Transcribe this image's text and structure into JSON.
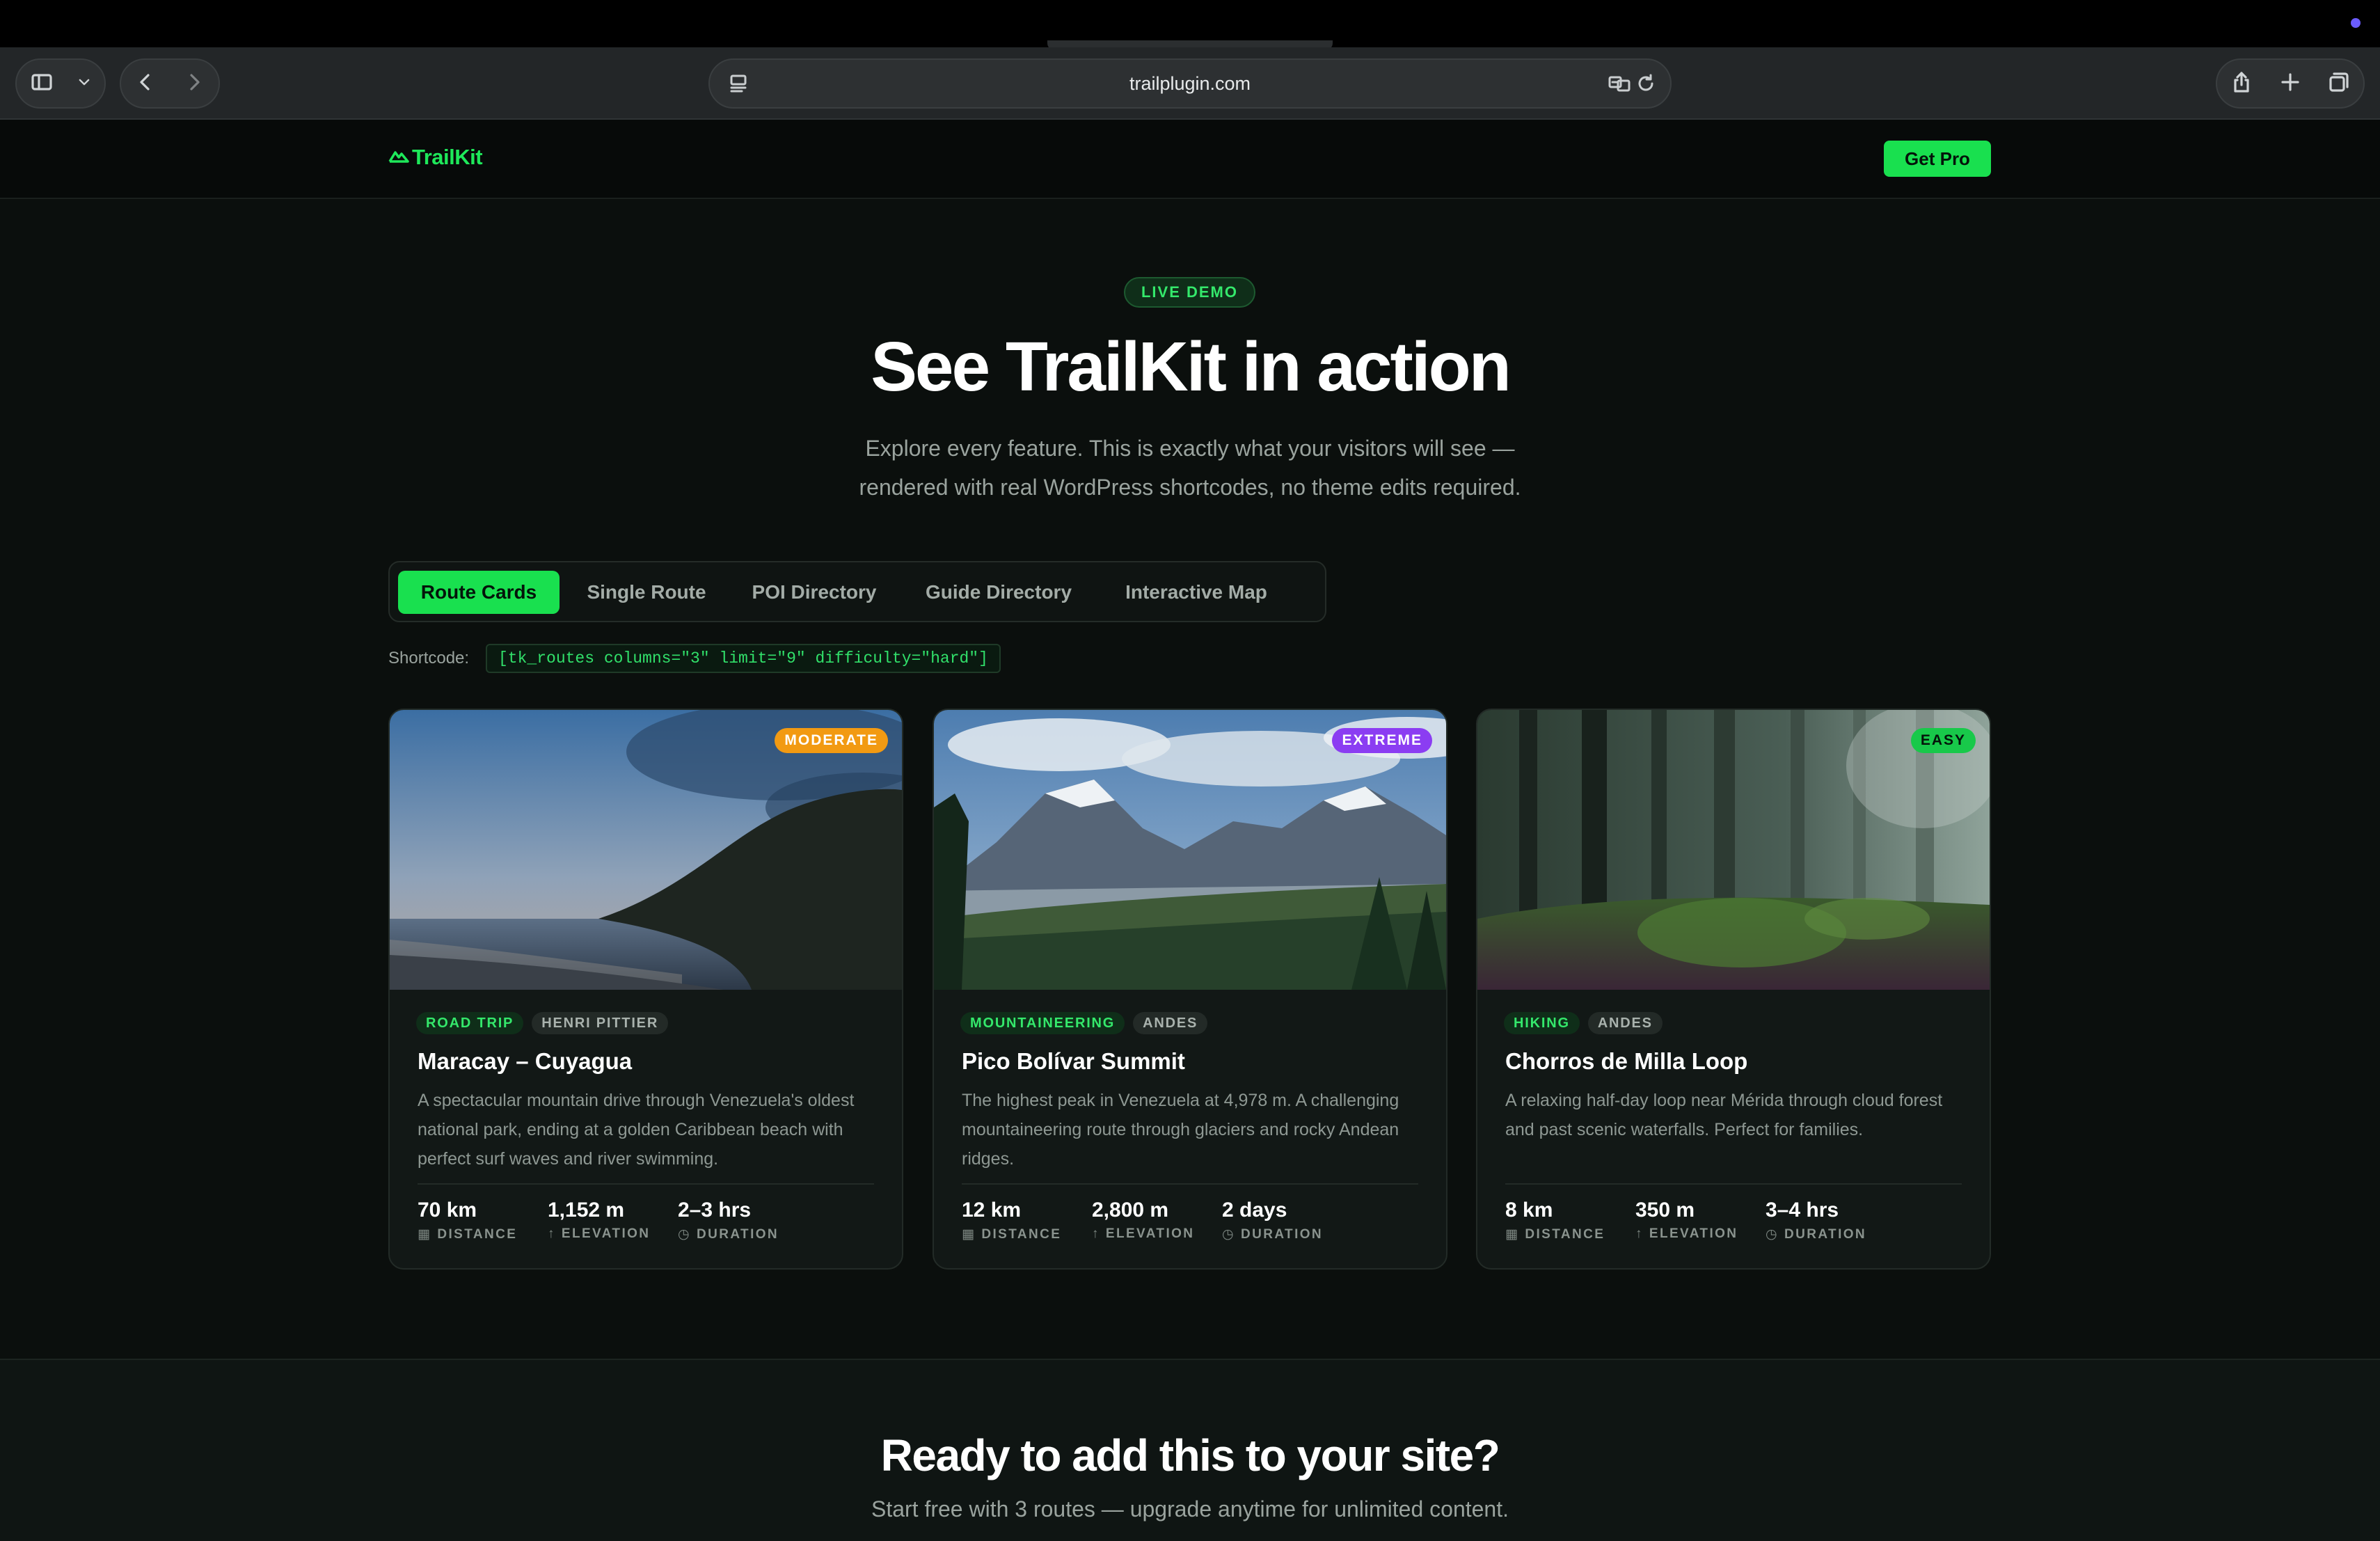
{
  "browser": {
    "url": "trailplugin.com",
    "icons": [
      "sidebar-icon",
      "chevron-down-icon",
      "back-icon",
      "forward-icon",
      "reader-icon",
      "translate-icon",
      "reload-icon",
      "share-icon",
      "plus-icon",
      "tabs-icon"
    ]
  },
  "nav": {
    "logo": "TrailKit",
    "cta": "Get Pro"
  },
  "hero": {
    "pill": "LIVE DEMO",
    "title": "See TrailKit in action",
    "subtitle_line1": "Explore every feature. This is exactly what your visitors will see —",
    "subtitle_line2": "rendered with real WordPress shortcodes, no theme edits required."
  },
  "tabs": [
    {
      "label": "Route Cards",
      "active": true
    },
    {
      "label": "Single Route",
      "active": false
    },
    {
      "label": "POI Directory",
      "active": false
    },
    {
      "label": "Guide Directory",
      "active": false
    },
    {
      "label": "Interactive Map",
      "active": false
    }
  ],
  "shortcode": {
    "label": "Shortcode:",
    "code": "[tk_routes columns=\"3\" limit=\"9\" difficulty=\"hard\"]"
  },
  "cards": [
    {
      "difficulty": "MODERATE",
      "difficulty_color": "#f29a12",
      "tags": [
        "ROAD TRIP",
        "HENRI PITTIER"
      ],
      "title": "Maracay – Cuyagua",
      "description": "A spectacular mountain drive through Venezuela's oldest national park, ending at a golden Caribbean beach with perfect surf waves and river swimming.",
      "stats": [
        {
          "value": "70 km",
          "label": "DISTANCE",
          "icon": "map-icon"
        },
        {
          "value": "1,152 m",
          "label": "ELEVATION",
          "icon": "arrow-up-icon"
        },
        {
          "value": "2–3 hrs",
          "label": "DURATION",
          "icon": "clock-icon"
        }
      ]
    },
    {
      "difficulty": "EXTREME",
      "difficulty_color": "#8b3df2",
      "tags": [
        "MOUNTAINEERING",
        "ANDES"
      ],
      "title": "Pico Bolívar Summit",
      "description": "The highest peak in Venezuela at 4,978 m. A challenging mountaineering route through glaciers and rocky Andean ridges.",
      "stats": [
        {
          "value": "12 km",
          "label": "DISTANCE",
          "icon": "map-icon"
        },
        {
          "value": "2,800 m",
          "label": "ELEVATION",
          "icon": "arrow-up-icon"
        },
        {
          "value": "2 days",
          "label": "DURATION",
          "icon": "clock-icon"
        }
      ]
    },
    {
      "difficulty": "EASY",
      "difficulty_color": "#18c94a",
      "tags": [
        "HIKING",
        "ANDES"
      ],
      "title": "Chorros de Milla Loop",
      "description": "A relaxing half-day loop near Mérida through cloud forest and past scenic waterfalls. Perfect for families.",
      "stats": [
        {
          "value": "8 km",
          "label": "DISTANCE",
          "icon": "map-icon"
        },
        {
          "value": "350 m",
          "label": "ELEVATION",
          "icon": "arrow-up-icon"
        },
        {
          "value": "3–4 hrs",
          "label": "DURATION",
          "icon": "clock-icon"
        }
      ]
    }
  ],
  "cta": {
    "title": "Ready to add this to your site?",
    "subtitle": "Start free with 3 routes — upgrade anytime for unlimited content."
  },
  "colors": {
    "accent": "#19e04f",
    "background": "#0b0f0d",
    "card": "#121816"
  }
}
